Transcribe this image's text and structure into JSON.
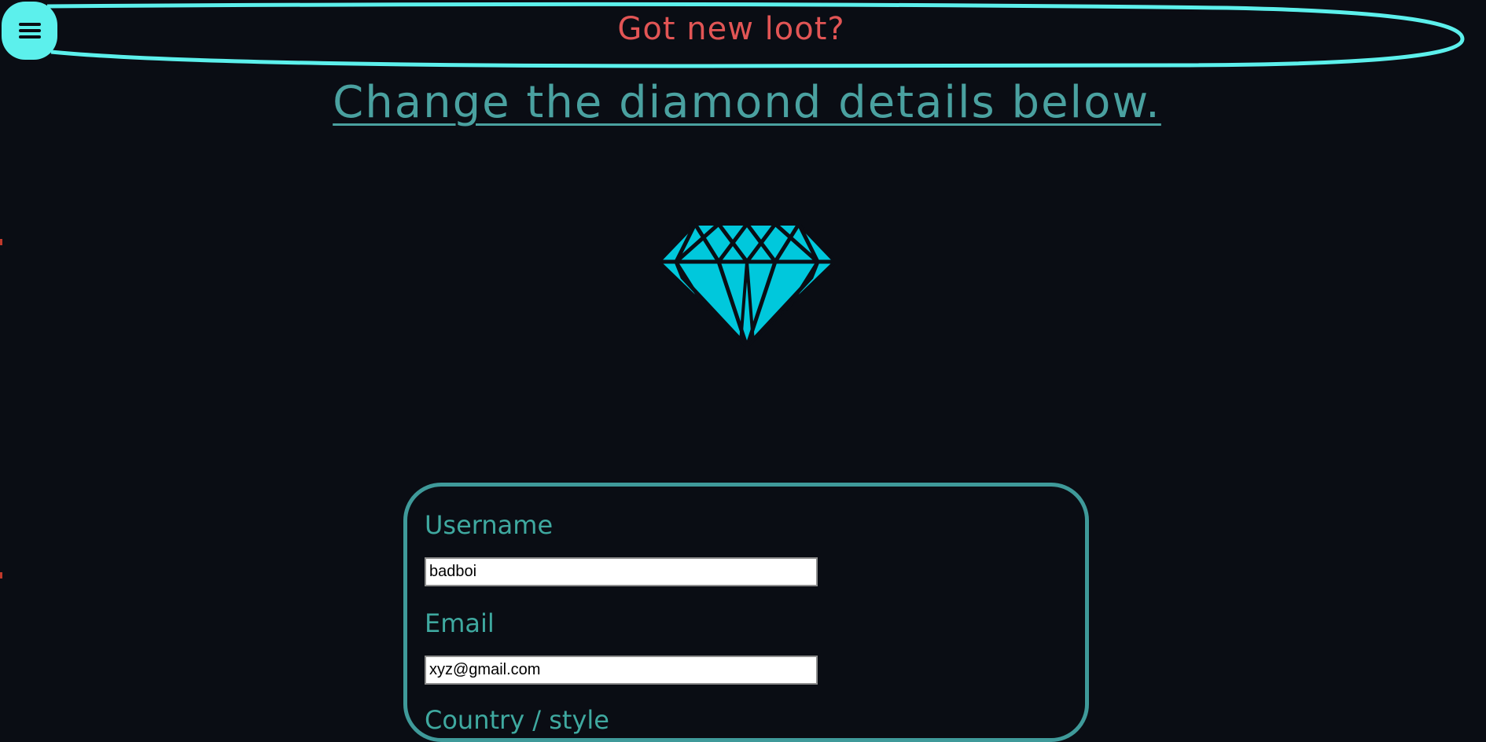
{
  "header": {
    "menu_icon": "hamburger-icon",
    "title": "Got new loot?"
  },
  "main": {
    "heading": "Change the diamond details below.",
    "image_icon": "diamond-icon"
  },
  "form": {
    "username_label": "Username",
    "username_value": "badboi",
    "email_label": "Email",
    "email_value": "xyz@gmail.com",
    "next_label_partial": "Country / style"
  },
  "colors": {
    "background": "#0a0d14",
    "accent": "#5cf0ec",
    "heading": "#4aa1a0",
    "title": "#e25555",
    "diamond": "#00c8dc"
  }
}
